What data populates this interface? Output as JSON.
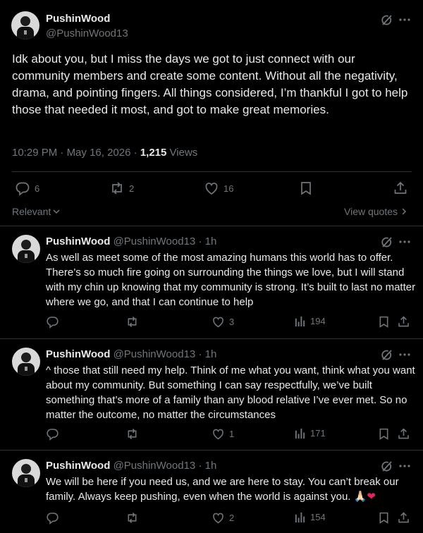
{
  "main_post": {
    "author_name": "PushinWood",
    "author_handle": "@PushinWood13",
    "text": "Idk about you, but I miss the days we got to just connect with our community members and create some content. Without all the negativity, drama, and pointing fingers. All things considered, I’m thankful I got to help those that needed it most, and got to make great memories.",
    "time": "10:29 PM",
    "separator": "·",
    "date": "May 16, 2026",
    "views_count": "1,215",
    "views_label": "Views",
    "replies": "6",
    "reposts": "2",
    "likes": "16",
    "sort_label": "Relevant",
    "quotes_label": "View quotes"
  },
  "replies": [
    {
      "author_name": "PushinWood",
      "author_handle": "@PushinWood13",
      "sep": "·",
      "age": "1h",
      "text": "As well as meet some of the most amazing humans this world has to offer. There’s so much fire going on surrounding the things we love, but I will stand with my chin up knowing that my community is strong. It’s built to last no matter where we go, and that I can continue to help",
      "replies": "",
      "reposts": "",
      "likes": "3",
      "views": "194"
    },
    {
      "author_name": "PushinWood",
      "author_handle": "@PushinWood13",
      "sep": "·",
      "age": "1h",
      "text": "^ those that still need my help. Think of me what you want, think what you want about my community. But something I can say respectfully, we’ve built something that’s more of a family than any blood relative I’ve ever met. So no matter the outcome, no matter the circumstances",
      "replies": "",
      "reposts": "",
      "likes": "1",
      "views": "171"
    },
    {
      "author_name": "PushinWood",
      "author_handle": "@PushinWood13",
      "sep": "·",
      "age": "1h",
      "text": "We will be here if you need us, and we are here to stay. You can’t break our family. Always keep pushing, even when the world is against you. 🙏🏻",
      "text_heart": "❤",
      "replies": "",
      "reposts": "",
      "likes": "2",
      "views": "154"
    }
  ],
  "icons": {
    "grok": "grok-icon",
    "more": "more-icon",
    "reply": "reply-icon",
    "repost": "repost-icon",
    "like": "like-icon",
    "bookmark": "bookmark-icon",
    "share": "share-icon",
    "views": "views-icon",
    "chevron_down": "chevron-down-icon",
    "chevron_right": "chevron-right-icon"
  },
  "colors": {
    "background": "#000000",
    "text": "#e7e9ea",
    "muted": "#71767b",
    "divider": "#2f3336",
    "heart_emoji": "#e0245e"
  }
}
